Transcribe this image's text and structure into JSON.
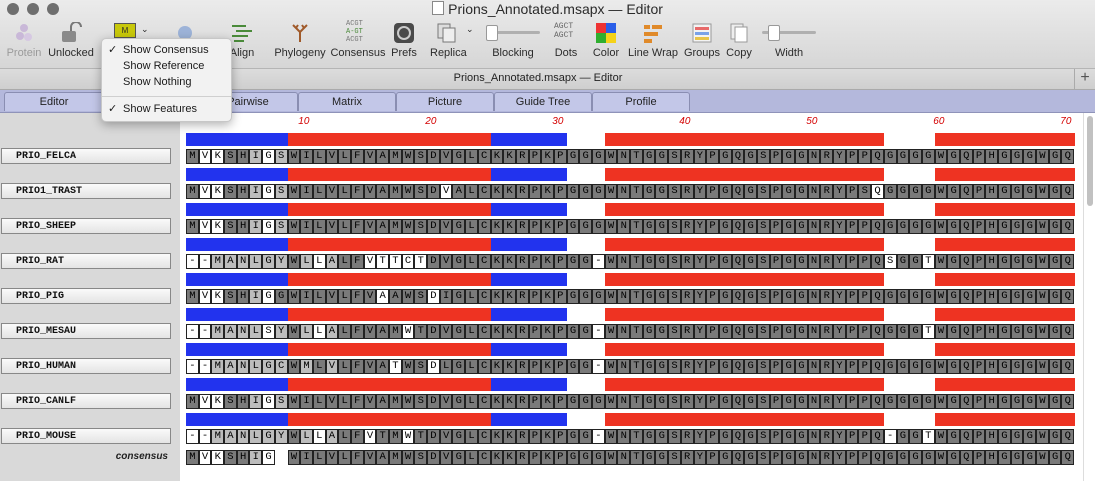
{
  "window": {
    "title": "Prions_Annotated.msapx — Editor",
    "subtitle": "Prions_Annotated.msapx — Editor"
  },
  "toolbar": {
    "protein": "Protein",
    "unlocked": "Unlocked",
    "align": "Align",
    "phylogeny": "Phylogeny",
    "consensus": "Consensus",
    "consensus_icon_text": [
      "ACGT",
      "A-GT",
      "ACGT"
    ],
    "prefs": "Prefs",
    "replica": "Replica",
    "blocking": "Blocking",
    "dots": "Dots",
    "dots_icon_text": [
      "AGCT",
      "AGCT"
    ],
    "color": "Color",
    "line_wrap": "Line Wrap",
    "groups": "Groups",
    "copy": "Copy",
    "width": "Width",
    "consensus_button_glyph": "M"
  },
  "menu": {
    "items": [
      {
        "label": "Show Consensus",
        "checked": "✓"
      },
      {
        "label": "Show Reference",
        "checked": ""
      },
      {
        "label": "Show Nothing",
        "checked": ""
      },
      {
        "label": "Show Features",
        "checked": "✓"
      }
    ]
  },
  "tabs": [
    "Editor",
    "Pairwise",
    "Matrix",
    "Picture",
    "Guide Tree",
    "Profile"
  ],
  "ruler": [
    "10",
    "20",
    "30",
    "40",
    "50",
    "60",
    "70"
  ],
  "colors": {
    "feature_blue": "#2233ee",
    "feature_red": "#ee3322",
    "tab_bar": "#b4b8dc"
  },
  "consensus_label": "consensus",
  "sequences": [
    {
      "name": "PRIO_FELCA",
      "seq": "MVKSHIGSWILVLFVAMWSDVGLCKKRPKPGGGWNTGGSRYPGQGSPGGNRYPPQGGGGWGQPHGGGWGQ",
      "shade": "dllddmlmddddddddddddddddddddddddddddddddddddddddddddddddddddddddddddddd"
    },
    {
      "name": "PRIO1_TRAST",
      "seq": "MVKSHIGSWILVLFVAMWSDVALCKKRPKPGGGWNTGGSRYPGQGSPGGNRYPSQGGGGWGQPHGGGWGQ",
      "shade": "dllddmlmddddddddddddwdddddddddddddddddddddddddddddddddwddddddddddddddd"
    },
    {
      "name": "PRIO_SHEEP",
      "seq": "MVKSHIGSWILVLFVAMWSDVGLCKKRPKPGGGWNTGGSRYPGQGSPGGNRYPPQGGGGWGQPHGGGWGQ",
      "shade": "dllddmlmddddddddddddddddddddddddddddddddddddddddddddddddddddddddddddddd"
    },
    {
      "name": "PRIO_RAT",
      "seq": "--MANLGYWLLALFVTTCTDVGLCKKRPKPGG-WNTGGSRYPGQGSPGGNRYPPQSGGTWGQPHGGGWGQ",
      "shade": "wwmmmmmmdmwmddwwwwwdddddddddddddwddddddddddddddddddddddwddwddddddddddd"
    },
    {
      "name": "PRIO_PIG",
      "seq": "MVKSHIGGWILVLFVAAWSDIGLCKKRPKPGGGWNTGGSRYPGQGSPGGNRYPPQGGGGWGQPHGGGWGQ",
      "shade": "dllddmlddddddddwdddwdddddddddddddddddddddddddddddddddddddddddddddddddd"
    },
    {
      "name": "PRIO_MESAU",
      "seq": "--MANLSYWLLALFVAMWTDVGLCKKRPKPGG-WNTGGSRYPGQGSPGGNRYPPQGGGTWGQPHGGGWGQ",
      "shade": "wwmmmmwmdmwmdddddwddddddddddddddwdddddddddddddddddddddddddwddddddddddd"
    },
    {
      "name": "PRIO_HUMAN",
      "seq": "--MANLGCWMLVLFVATWSDLGLCKKRPKPGG-WNTGGSRYPGQGSPGGNRYPPQGGGGWGQPHGGGWGQ",
      "shade": "wwmmmmmmdmdmddddwddwddddddddddddwddddddddddddddddddddddddddddddddddddd"
    },
    {
      "name": "PRIO_CANLF",
      "seq": "MVKSHIGSWILVLFVAMWSDVGLCKKRPKPGGGWNTGGSRYPGQGSPGGNRYPPQGGGGWGQPHGGGWGQ",
      "shade": "dllddmlmddddddddddddddddddddddddddddddddddddddddddddddddddddddddddddddd"
    },
    {
      "name": "PRIO_MOUSE",
      "seq": "--MANLGYWLLALFVTMWTDVGLCKKRPKPGG-WNTGGSRYPGQGSPGGNRYPPQ-GGTWGQPHGGGWGQ",
      "shade": "wwmmmmmmdmwmddwddwddddddddddddddwddddddddddddddddddddddwddwddddddddddd"
    }
  ],
  "consensus": {
    "seq": "MVKSHIG WILVLFVAMWSDVGLCKKRPKPGGGWNTGGSRYPGQGSPGGNRYPPQGGGGWGQPHGGGWGQ",
    "shade": "dllddmlwdddddddddddddddddddddddddddddddddddddddddddddddddddddddddddddd"
  },
  "features": [
    {
      "start": 1,
      "end": 8,
      "color": "blue"
    },
    {
      "start": 9,
      "end": 24,
      "color": "red"
    },
    {
      "start": 25,
      "end": 30,
      "color": "blue"
    },
    {
      "start": 34,
      "end": 55,
      "color": "red"
    },
    {
      "start": 60,
      "end": 70,
      "color": "red"
    }
  ]
}
